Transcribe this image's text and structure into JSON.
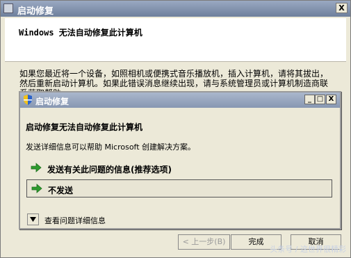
{
  "outer_window": {
    "title": "启动修复",
    "close_label": "X",
    "header_title": "Windows 无法自动修复此计算机",
    "body_text": "如果您最近将一个设备，如照相机或便携式音乐播放机，插入计算机，请将其拔出，然后重新启动计算机。如果此错误消息继续出现，请与系统管理员或计算机制造商联系获取帮助。",
    "buttons": {
      "back": "< 上一步(B)",
      "finish": "完成",
      "cancel": "取消"
    },
    "watermark": "头条号 / 这世界很精彩"
  },
  "dialog": {
    "title": "启动修复",
    "minimize": "_",
    "maximize": "□",
    "close": "X",
    "heading": "启动修复无法自动修复此计算机",
    "description": "发送详细信息可以帮助 Microsoft 创建解决方案。",
    "options": [
      {
        "label": "发送有关此问题的信息(推荐选项)"
      },
      {
        "label": "不发送"
      }
    ],
    "details_label": "查看问题详细信息"
  },
  "colors": {
    "accent_arrow": "#2e9b2e",
    "titlebar": "#8797b2"
  }
}
